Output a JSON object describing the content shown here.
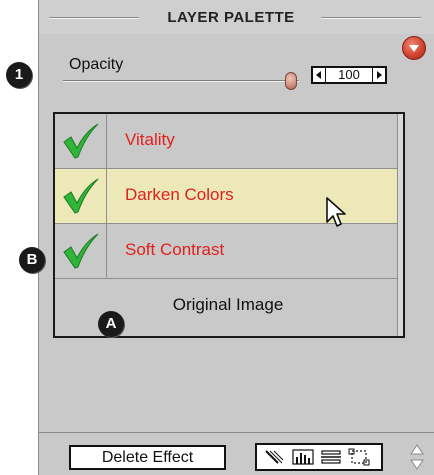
{
  "palette": {
    "title": "LAYER PALETTE",
    "menu_icon": "palette-menu-icon"
  },
  "opacity": {
    "label": "Opacity",
    "value": "100",
    "slider_level": 1.0
  },
  "layers": [
    {
      "name": "Vitality",
      "checked": true,
      "highlighted": false
    },
    {
      "name": "Darken Colors",
      "checked": true,
      "highlighted": true
    },
    {
      "name": "Soft Contrast",
      "checked": true,
      "highlighted": false
    },
    {
      "name": "Original Image",
      "checked": false,
      "highlighted": false
    }
  ],
  "toolbar": {
    "delete_label": "Delete Effect",
    "tools": [
      "brush-icon",
      "histogram-icon",
      "align-icon",
      "crop-icon"
    ]
  },
  "callouts": {
    "badge_1": "1",
    "badge_b": "B",
    "badge_a": "A"
  },
  "colors": {
    "layer_text": "#e0211d",
    "highlight_row": "#ece8b8",
    "panel": "#c9c9c9",
    "check": "#2fb537"
  }
}
